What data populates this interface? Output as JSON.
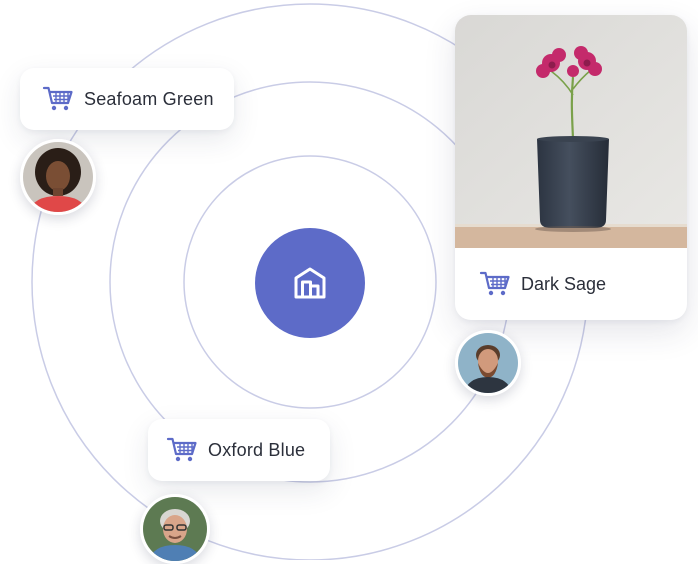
{
  "colors": {
    "accent": "#5d6bc8",
    "ring": "#c9cce6",
    "text": "#2b2f3a"
  },
  "hub": {
    "icon": "building-icon"
  },
  "tags": [
    {
      "label": "Seafoam Green",
      "icon": "shopping-cart-icon"
    },
    {
      "label": "Oxford Blue",
      "icon": "shopping-cart-icon"
    }
  ],
  "product_card": {
    "label": "Dark Sage",
    "icon": "shopping-cart-icon",
    "photo": "flower-in-vase-photo"
  },
  "avatars": [
    {
      "name": "woman-avatar"
    },
    {
      "name": "bearded-man-avatar"
    },
    {
      "name": "older-man-avatar"
    }
  ]
}
